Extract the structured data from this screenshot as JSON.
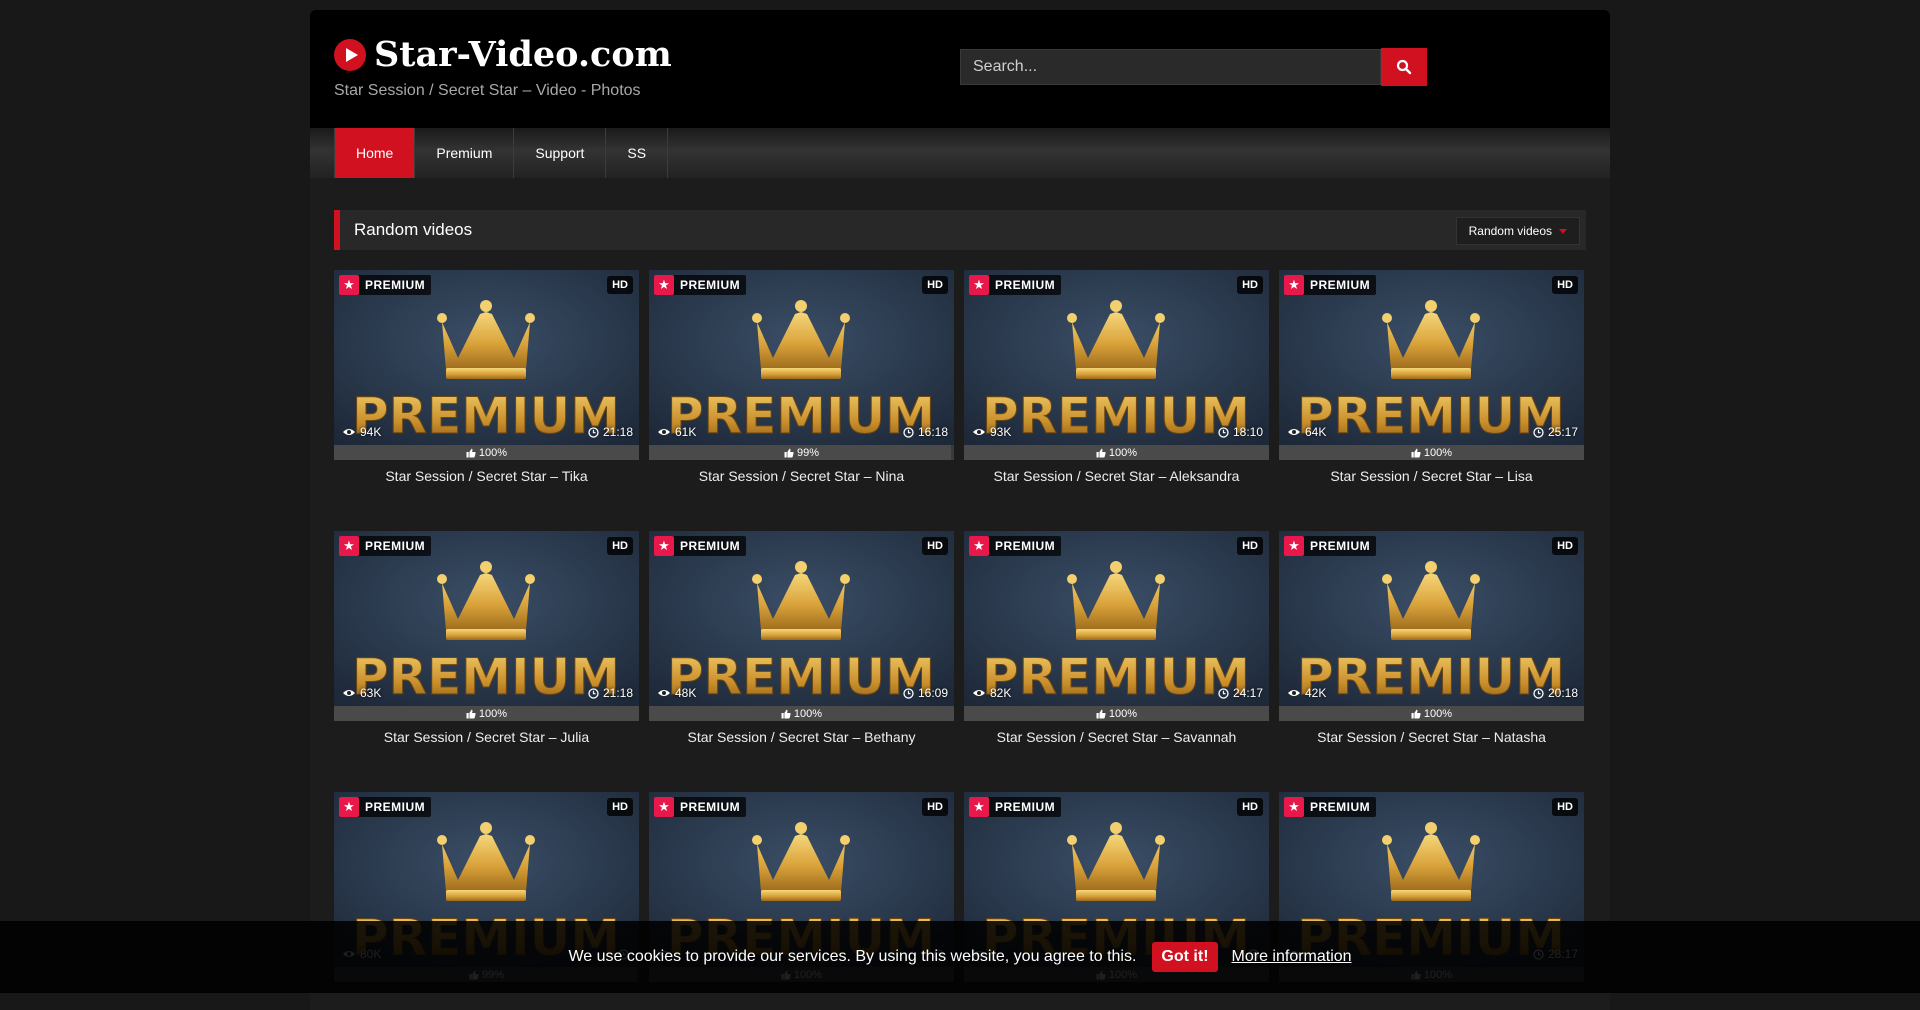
{
  "header": {
    "logo_text": "Star-Video.com",
    "tagline": "Star Session / Secret Star – Video - Photos",
    "search_placeholder": "Search..."
  },
  "nav": {
    "items": [
      {
        "label": "Home",
        "active": true
      },
      {
        "label": "Premium"
      },
      {
        "label": "Support"
      },
      {
        "label": "SS"
      }
    ]
  },
  "section": {
    "title": "Random videos",
    "filter_label": "Random videos"
  },
  "video_badges": {
    "premium": "PREMIUM",
    "hd": "HD",
    "thumbnail_text": "PREMIUM"
  },
  "videos": [
    {
      "title": "Star Session / Secret Star – Tika",
      "views": "94K",
      "duration": "21:18",
      "rating": "100%"
    },
    {
      "title": "Star Session / Secret Star – Nina",
      "views": "61K",
      "duration": "16:18",
      "rating": "99%"
    },
    {
      "title": "Star Session / Secret Star – Aleksandra",
      "views": "93K",
      "duration": "18:10",
      "rating": "100%"
    },
    {
      "title": "Star Session / Secret Star – Lisa",
      "views": "64K",
      "duration": "25:17",
      "rating": "100%"
    },
    {
      "title": "Star Session / Secret Star – Julia",
      "views": "63K",
      "duration": "21:18",
      "rating": "100%"
    },
    {
      "title": "Star Session / Secret Star – Bethany",
      "views": "48K",
      "duration": "16:09",
      "rating": "100%"
    },
    {
      "title": "Star Session / Secret Star – Savannah",
      "views": "82K",
      "duration": "24:17",
      "rating": "100%"
    },
    {
      "title": "Star Session / Secret Star – Natasha",
      "views": "42K",
      "duration": "20:18",
      "rating": "100%"
    },
    {
      "title": "",
      "views": "80K",
      "duration": "",
      "rating": "99%"
    },
    {
      "title": "",
      "views": "",
      "duration": "",
      "rating": "100%"
    },
    {
      "title": "",
      "views": "",
      "duration": "",
      "rating": "100%"
    },
    {
      "title": "",
      "views": "",
      "duration": "28:17",
      "rating": "100%"
    }
  ],
  "cookie": {
    "message": "We use cookies to provide our services. By using this website, you agree to this.",
    "accept_label": "Got it!",
    "more_label": "More information"
  },
  "colors": {
    "accent": "#d11020",
    "premium_star": "#e8194a",
    "background": "#181818"
  }
}
